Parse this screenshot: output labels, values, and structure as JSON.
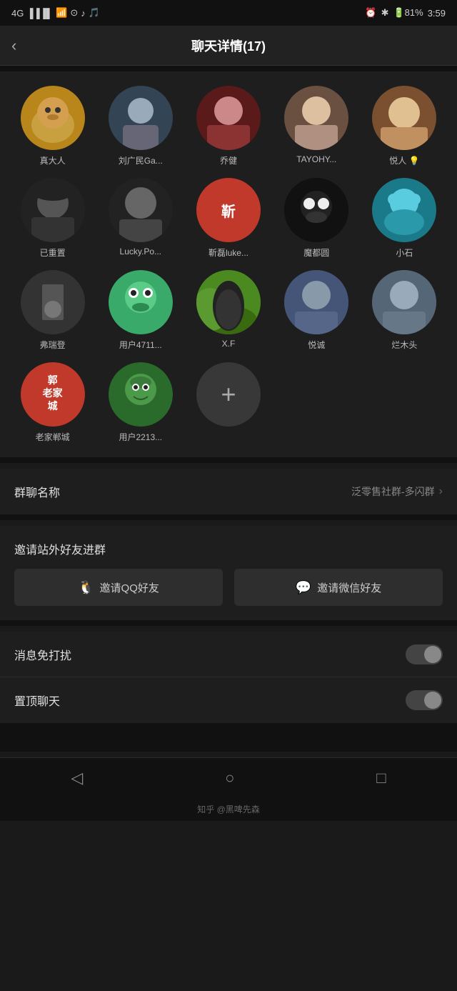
{
  "statusBar": {
    "signal": "4G",
    "time": "3:59",
    "battery": "81%"
  },
  "header": {
    "back": "‹",
    "title": "聊天详情(17)"
  },
  "members": [
    {
      "name": "真大人",
      "avatarClass": "av-dog",
      "emoji": "🐕"
    },
    {
      "name": "刘广民Ga...",
      "avatarClass": "av-man-bg",
      "emoji": "🧍"
    },
    {
      "name": "乔健",
      "avatarClass": "av-girl-red",
      "emoji": "👩"
    },
    {
      "name": "TAYOHY...",
      "avatarClass": "av-lady-vintage",
      "emoji": "👩"
    },
    {
      "name": "悦人 💡",
      "avatarClass": "av-lady2",
      "emoji": "👩"
    },
    {
      "name": "已重置",
      "avatarClass": "av-hat-man",
      "emoji": "🎩"
    },
    {
      "name": "Lucky.Po...",
      "avatarClass": "av-suit-man",
      "emoji": "🧍"
    },
    {
      "name": "靳磊luke...",
      "avatarClass": "av-chinese-char",
      "char": "靳"
    },
    {
      "name": "魔都圆",
      "avatarClass": "av-bear",
      "emoji": "🐼"
    },
    {
      "name": "小石",
      "avatarClass": "av-blue-monster",
      "emoji": "👾"
    },
    {
      "name": "弗瑞登",
      "avatarClass": "av-runner",
      "emoji": "🏃"
    },
    {
      "name": "用户4711...",
      "avatarClass": "av-green-monster",
      "emoji": "👾"
    },
    {
      "name": "X.F",
      "avatarClass": "av-horse",
      "emoji": "🐎"
    },
    {
      "name": "悦诚",
      "avatarClass": "av-man-lake",
      "emoji": "🧍"
    },
    {
      "name": "烂木头",
      "avatarClass": "av-outdoor",
      "emoji": "🏕️"
    },
    {
      "name": "老家郸城",
      "avatarClass": "av-郭",
      "char": "郭老家城"
    },
    {
      "name": "用户2213...",
      "avatarClass": "av-frog",
      "emoji": "🐸"
    }
  ],
  "addButton": "+",
  "settings": {
    "groupName": {
      "label": "群聊名称",
      "value": "泛零售社群-多闪群"
    }
  },
  "invite": {
    "title": "邀请站外好友进群",
    "qqBtn": "邀请QQ好友",
    "wechatBtn": "邀请微信好友"
  },
  "toggles": [
    {
      "label": "消息免打扰"
    },
    {
      "label": "置顶聊天"
    }
  ],
  "bottomNav": {
    "back": "◁",
    "home": "○",
    "recent": "□"
  },
  "watermark": "知乎 @黑啤先森"
}
